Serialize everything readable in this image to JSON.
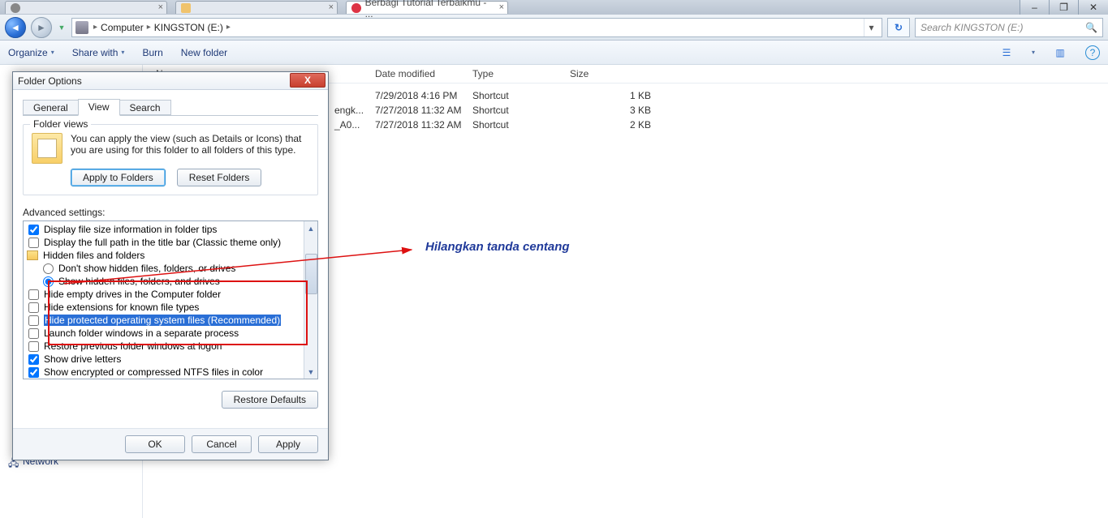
{
  "chrome": {
    "tabs": [
      {
        "title": "",
        "kind": "grey"
      },
      {
        "title": "",
        "kind": "yellow"
      },
      {
        "title": "Berbagi Tutorial Terbaikmu - ...",
        "kind": "red"
      }
    ],
    "win_minimize": "–",
    "win_restore": "❐",
    "win_close": "✕"
  },
  "nav": {
    "crumb1": "Computer",
    "crumb2": "KINGSTON (E:)",
    "sep": "▸",
    "refresh": "↻",
    "search_placeholder": "Search KINGSTON (E:)"
  },
  "toolbar": {
    "organize": "Organize",
    "sharewith": "Share with",
    "burn": "Burn",
    "newfolder": "New folder",
    "dd": "▾",
    "help": "?"
  },
  "columns": {
    "name": "Name",
    "date": "Date modified",
    "type": "Type",
    "size": "Size"
  },
  "files": [
    {
      "name": "",
      "date": "7/29/2018 4:16 PM",
      "type": "Shortcut",
      "size": "1 KB"
    },
    {
      "name": "engk...",
      "date": "7/27/2018 11:32 AM",
      "type": "Shortcut",
      "size": "3 KB"
    },
    {
      "name": "_A0...",
      "date": "7/27/2018 11:32 AM",
      "type": "Shortcut",
      "size": "2 KB"
    }
  ],
  "sidebar": {
    "network": "Network"
  },
  "dialog": {
    "title": "Folder Options",
    "close_x": "X",
    "tab_general": "General",
    "tab_view": "View",
    "tab_search": "Search",
    "group_folder_views": "Folder views",
    "fv_text": "You can apply the view (such as Details or Icons) that you are using for this folder to all folders of this type.",
    "btn_apply_folders": "Apply to Folders",
    "btn_reset_folders": "Reset Folders",
    "adv_label": "Advanced settings:",
    "adv": {
      "r0": "Display file size information in folder tips",
      "r1": "Display the full path in the title bar (Classic theme only)",
      "r2": "Hidden files and folders",
      "r3": "Don't show hidden files, folders, or drives",
      "r4": "Show hidden files, folders, and drives",
      "r5": "Hide empty drives in the Computer folder",
      "r6": "Hide extensions for known file types",
      "r7": "Hide protected operating system files (Recommended)",
      "r8": "Launch folder windows in a separate process",
      "r9": "Restore previous folder windows at logon",
      "r10": "Show drive letters",
      "r11": "Show encrypted or compressed NTFS files in color"
    },
    "btn_restore_defaults": "Restore Defaults",
    "btn_ok": "OK",
    "btn_cancel": "Cancel",
    "btn_apply": "Apply"
  },
  "annotation": {
    "text": "Hilangkan tanda centang"
  }
}
